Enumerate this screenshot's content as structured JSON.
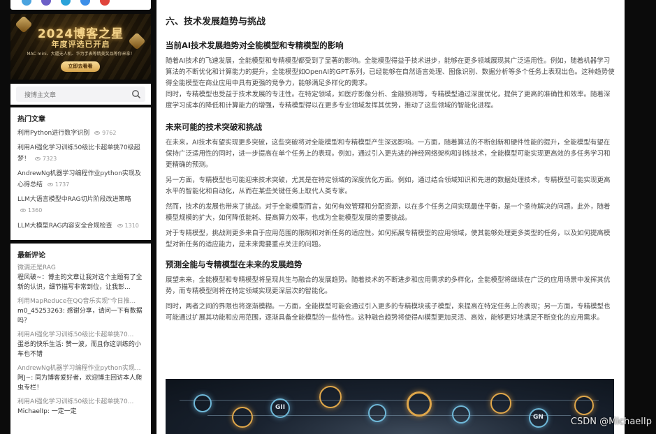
{
  "sidebar": {
    "banner": {
      "title": "2024博客之星",
      "subtitle": "年度评选已开启",
      "small_text": "MAC mini、大疆无人机、华为手表等精美奖品等你来拿！",
      "button_label": "立即去看看"
    },
    "search": {
      "placeholder": "搜博主文章"
    },
    "hot": {
      "title": "热门文章",
      "items": [
        {
          "label": "利用Python进行数字识别",
          "views": "9762"
        },
        {
          "label": "利用AI强化学习训练50级比卡超单挑70级超梦！",
          "views": "7323"
        },
        {
          "label": "AndrewNg机器学习编程作业python实现及心得总结",
          "views": "1737"
        },
        {
          "label": "LLM大语言模型中RAG切片阶段改进策略",
          "views": "1360"
        },
        {
          "label": "LLM大模型RAG内容安全合规检查",
          "views": "1310"
        }
      ]
    },
    "comments": {
      "title": "最新评论",
      "items": [
        {
          "link": "微调还是RAG",
          "body": "程风破~：博主的文章让我对这个主题有了全新的认识，细节描写非常到位，让我彰..."
        },
        {
          "link": "利用MapReduce在QQ音乐实现\"今日推...",
          "body": "m0_45253263: 感谢分享，请问一下有数据吗？"
        },
        {
          "link": "利用AI强化学习训练50级比卡超单挑70...",
          "body": "蛋总的快乐生活: 赞一波，而且你这训练的小车也不错"
        },
        {
          "link": "AndrewNg机器学习编程作业python实现...",
          "body": "阿J~: 同为博客爱好者，欢迎博主回访本人爬虫专栏！"
        },
        {
          "link": "利用AI强化学习训练50级比卡超单挑70...",
          "body": "MichaelIp: 一定一定"
        }
      ]
    }
  },
  "article": {
    "section_title": "六、技术发展趋势与挑战",
    "blocks": [
      {
        "heading": "当前AI技术发展趋势对全能模型和专精模型的影响",
        "paras": [
          "随着AI技术的飞速发展，全能模型和专精模型都受到了显著的影响。全能模型得益于技术进步，能够在更多领域展现其广泛适用性。例如，随着机器学习算法的不断优化和计算能力的提升，全能模型如OpenAI的GPT系列，已经能够在自然语言处理、图像识别、数据分析等多个任务上表现出色。这种趋势使得全能模型在商业应用中具有更强的竞争力，能够满足多样化的需求。",
          "同时，专精模型也受益于技术发展的专注性。在特定领域，如医疗影像分析、金融预测等，专精模型通过深度优化，提供了更高的准确性和效率。随着深度学习成本的降低和计算能力的增强，专精模型得以在更多专业领域发挥其优势，推动了这些领域的智能化进程。"
        ]
      },
      {
        "heading": "未来可能的技术突破和挑战",
        "paras": [
          "在未来，AI技术有望实现更多突破，这些突破将对全能模型和专精模型产生深远影响。一方面，随着算法的不断创新和硬件性能的提升，全能模型有望在保持广泛适用性的同时，进一步提高在单个任务上的表现。例如，通过引入更先进的神经网络架构和训练技术，全能模型可能实现更高效的多任务学习和更精确的预测。",
          "另一方面，专精模型也可能迎来技术突破，尤其是在特定领域的深度优化方面。例如，通过结合领域知识和先进的数据处理技术，专精模型可能实现更高水平的智能化和自动化，从而在某些关键任务上取代人类专家。",
          "然而，技术的发展也带来了挑战。对于全能模型而言，如何有效管理和分配资源，以在多个任务之间实现最佳平衡，是一个亟待解决的问题。此外，随着模型规模的扩大，如何降低能耗、提高算力效率，也成为全能模型发展的重要挑战。",
          "对于专精模型，挑战则更多来自于应用范围的限制和对新任务的适应性。如何拓展专精模型的应用领域，使其能够处理更多类型的任务，以及如何提高模型对新任务的适应能力，是未来需要重点关注的问题。"
        ]
      },
      {
        "heading": "预测全能与专精模型在未来的发展趋势",
        "paras": [
          "展望未来，全能模型和专精模型将呈现共生与融合的发展趋势。随着技术的不断进步和应用需求的多样化，全能模型将继续在广泛的应用场景中发挥其优势，而专精模型则将在特定领域实现更深层次的智能化。",
          "同时，两者之间的界限也将逐渐模糊。一方面，全能模型可能会通过引入更多的专精模块或子模型，来提高在特定任务上的表现；另一方面，专精模型也可能通过扩展其功能和应用范围，逐渐具备全能模型的一些特性。这种融合趋势将使得AI模型更加灵活、高效，能够更好地满足不断变化的应用需求。"
        ]
      }
    ],
    "image_labels": [
      "GII",
      "GN"
    ]
  },
  "watermark": "CSDN @MichaelIp",
  "colors": {
    "background": "#0b0b0b",
    "card": "#ffffff",
    "heading": "#222222",
    "body_text": "#4d4d4d",
    "muted": "#999999"
  }
}
